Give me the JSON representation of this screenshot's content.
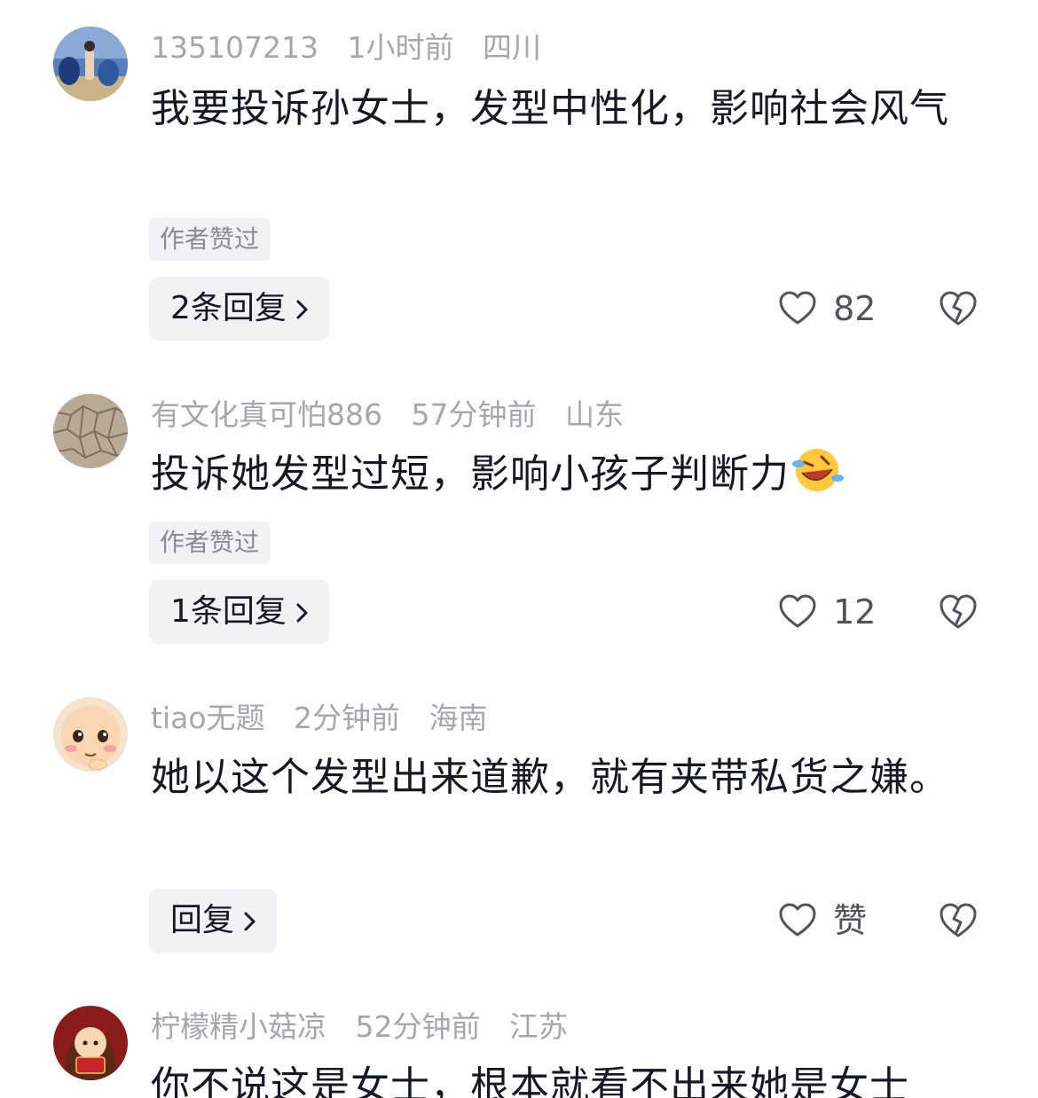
{
  "comments": [
    {
      "username": "135107213",
      "time": "1小时前",
      "location": "四川",
      "text": "我要投诉孙女士，发型中性化，影响社会风气",
      "author_liked_tag": "作者赞过",
      "reply_label": "2条回复",
      "like_count": "82",
      "avatar_icon": "avatar-photo-beach"
    },
    {
      "username": "有文化真可怕886",
      "time": "57分钟前",
      "location": "山东",
      "text": "投诉她发型过短，影响小孩子判断力",
      "emoji": "rolling-laughing-emoji",
      "author_liked_tag": "作者赞过",
      "reply_label": "1条回复",
      "like_count": "12",
      "avatar_icon": "avatar-cracked-earth"
    },
    {
      "username": "tiao无题",
      "time": "2分钟前",
      "location": "海南",
      "text": "她以这个发型出来道歉，就有夹带私货之嫌。",
      "reply_label": "回复",
      "like_count": "赞",
      "avatar_icon": "avatar-cartoon-face"
    },
    {
      "username": "柠檬精小菇凉",
      "time": "52分钟前",
      "location": "江苏",
      "text": "你不说这是女士，根本就看不出来她是女士",
      "avatar_icon": "avatar-cartoon-girl"
    }
  ],
  "colors": {
    "text_primary": "#161823",
    "text_meta": "#a5a7ad",
    "pill_bg": "#f2f2f4",
    "icon_stroke": "#51535b"
  }
}
